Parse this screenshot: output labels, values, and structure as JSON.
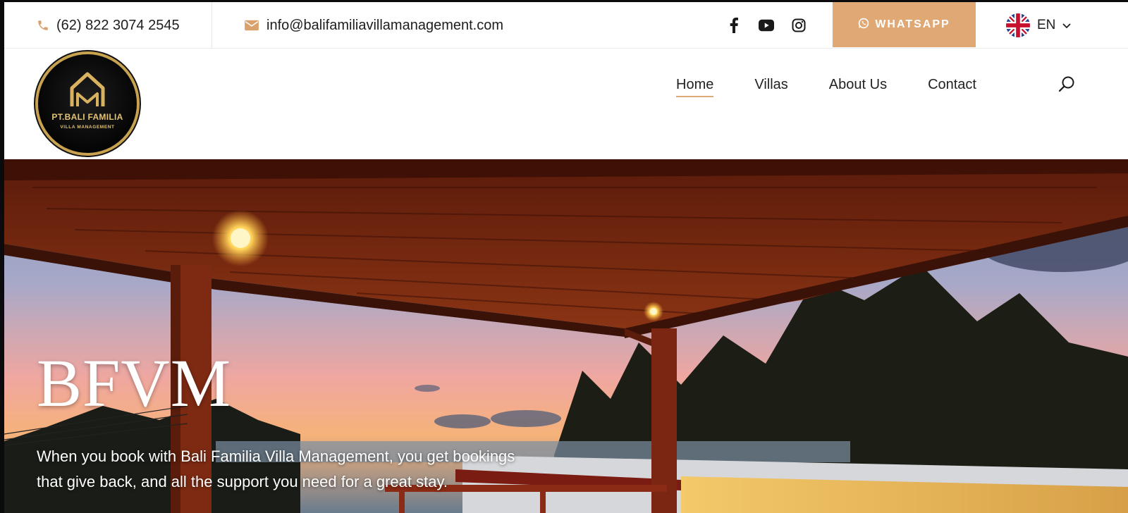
{
  "topbar": {
    "phone": "(62) 822 3074 2545",
    "email": "info@balifamiliavillamanagement.com",
    "social_icons": [
      "facebook-icon",
      "youtube-icon",
      "instagram-icon"
    ],
    "whatsapp_label": "WHATSAPP",
    "language": "EN",
    "accent_color": "#dfa874"
  },
  "logo": {
    "line1": "PT.BALI FAMILIA",
    "line2": "VILLA MANAGEMENT"
  },
  "nav": {
    "items": [
      {
        "label": "Home",
        "active": true
      },
      {
        "label": "Villas",
        "active": false
      },
      {
        "label": "About Us",
        "active": false
      },
      {
        "label": "Contact",
        "active": false
      }
    ]
  },
  "hero": {
    "title": "BFVM",
    "subtitle_line1": "When you book with Bali Familia Villa Management, you get bookings",
    "subtitle_line2": "that give back, and all the support you need for a great stay."
  }
}
